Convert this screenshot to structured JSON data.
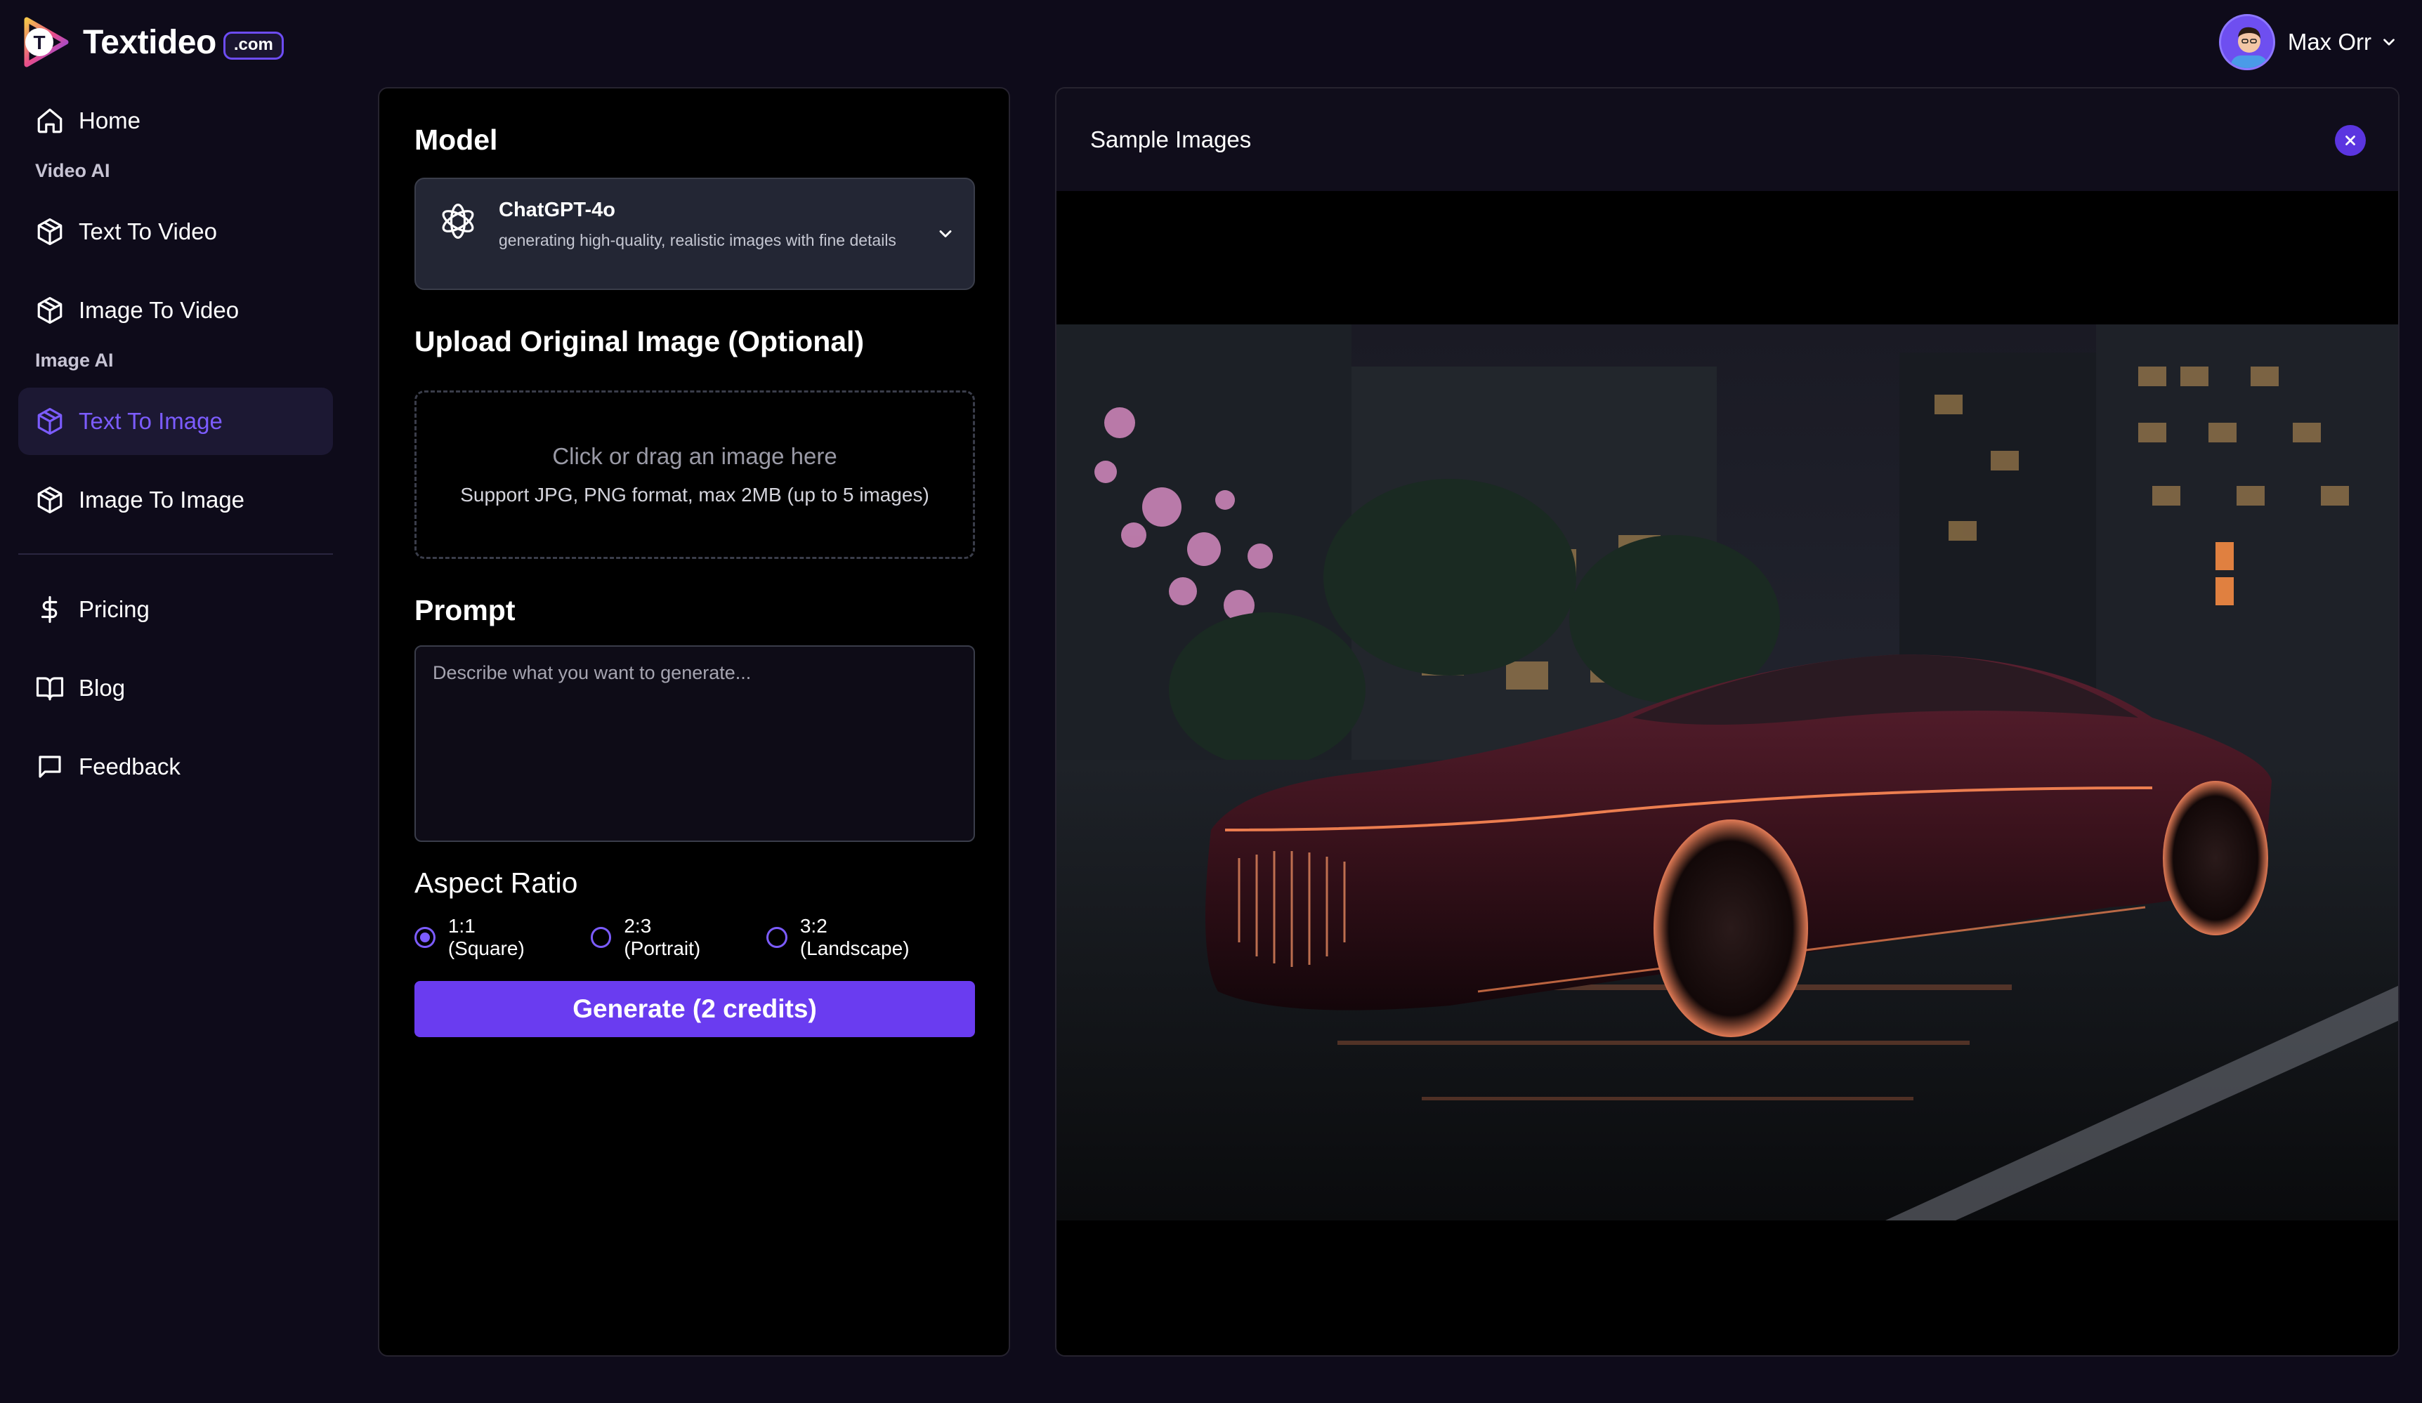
{
  "brand": {
    "name": "Textideo",
    "badge": ".com"
  },
  "user": {
    "name": "Max Orr"
  },
  "sidebar": {
    "home": "Home",
    "video_section": "Video AI",
    "video_items": [
      "Text To Video",
      "Image To Video"
    ],
    "image_section": "Image AI",
    "image_items": [
      "Text To Image",
      "Image To Image"
    ],
    "active": "Text To Image",
    "bottom_items": [
      "Pricing",
      "Blog",
      "Feedback"
    ]
  },
  "form": {
    "model_title": "Model",
    "model": {
      "name": "ChatGPT-4o",
      "description": "generating high-quality, realistic images with fine details"
    },
    "upload_title": "Upload Original Image (Optional)",
    "upload_main": "Click or drag an image here",
    "upload_sub": "Support JPG, PNG format, max 2MB (up to 5 images)",
    "prompt_title": "Prompt",
    "prompt_placeholder": "Describe what you want to generate...",
    "prompt_value": "",
    "aspect_title": "Aspect Ratio",
    "aspect_options": [
      "1:1 (Square)",
      "2:3 (Portrait)",
      "3:2 (Landscape)"
    ],
    "aspect_selected": "1:1 (Square)",
    "generate_label": "Generate (2 credits)"
  },
  "sample": {
    "title": "Sample Images"
  },
  "colors": {
    "accent": "#6a3cf0",
    "accent_light": "#7c5cff",
    "background": "#0e0b1a",
    "panel": "#000000"
  }
}
